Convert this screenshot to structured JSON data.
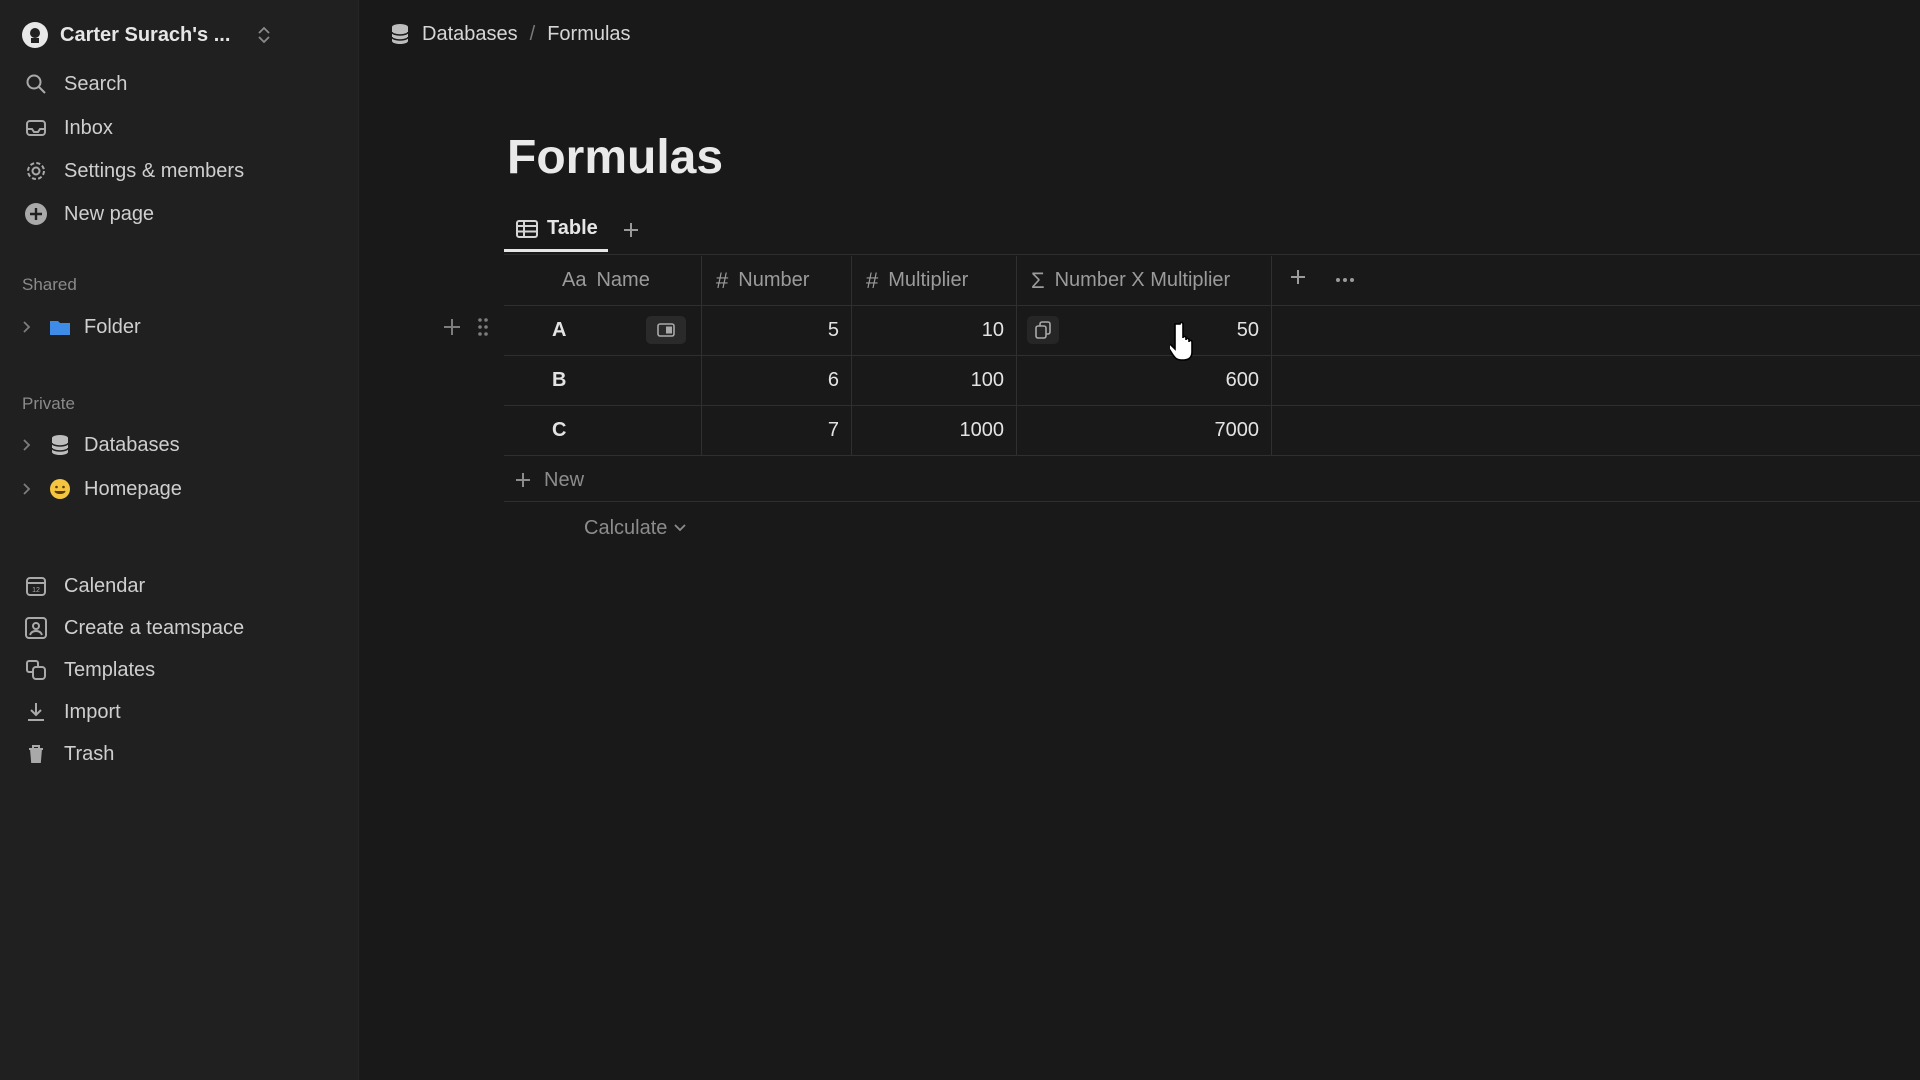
{
  "sidebar": {
    "workspace_name": "Carter Surach's ...",
    "nav": [
      {
        "label": "Search",
        "icon": "search-icon"
      },
      {
        "label": "Inbox",
        "icon": "inbox-icon"
      },
      {
        "label": "Settings & members",
        "icon": "gear-icon"
      },
      {
        "label": "New page",
        "icon": "plus-circle-icon"
      }
    ],
    "shared_label": "Shared",
    "shared_items": [
      {
        "label": "Folder",
        "icon": "folder-icon"
      }
    ],
    "private_label": "Private",
    "private_items": [
      {
        "label": "Databases",
        "icon": "database-icon"
      },
      {
        "label": "Homepage",
        "icon": "emoji-icon"
      }
    ],
    "bottom": [
      {
        "label": "Calendar",
        "icon": "calendar-icon"
      },
      {
        "label": "Create a teamspace",
        "icon": "teamspace-icon"
      },
      {
        "label": "Templates",
        "icon": "templates-icon"
      },
      {
        "label": "Import",
        "icon": "import-icon"
      },
      {
        "label": "Trash",
        "icon": "trash-icon"
      }
    ]
  },
  "breadcrumb": {
    "items": [
      "Databases",
      "Formulas"
    ],
    "separator": "/"
  },
  "page": {
    "title": "Formulas",
    "view_tab": "Table",
    "columns": [
      {
        "prefix": "Aa",
        "label": "Name"
      },
      {
        "prefix": "#",
        "label": "Number"
      },
      {
        "prefix": "#",
        "label": "Multiplier"
      },
      {
        "prefix": "Σ",
        "label": "Number X Multiplier"
      }
    ],
    "rows": [
      {
        "name": "A",
        "number": "5",
        "multiplier": "10",
        "product": "50"
      },
      {
        "name": "B",
        "number": "6",
        "multiplier": "100",
        "product": "600"
      },
      {
        "name": "C",
        "number": "7",
        "multiplier": "1000",
        "product": "7000"
      }
    ],
    "new_row_label": "New",
    "calculate_label": "Calculate"
  },
  "colors": {
    "background": "#191919",
    "sidebar": "#202020",
    "folder": "#3f8ce8"
  }
}
